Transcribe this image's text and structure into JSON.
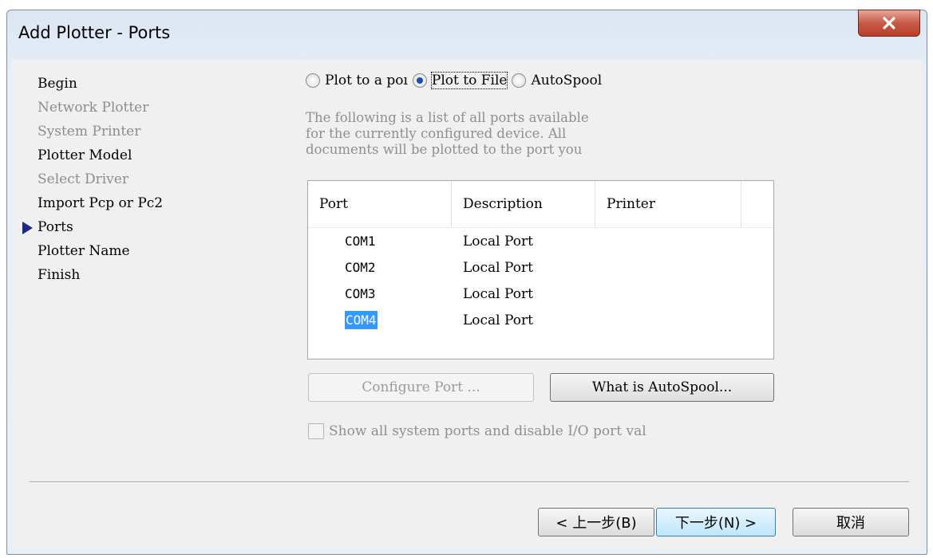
{
  "window": {
    "title": "Add Plotter - Ports"
  },
  "steps": [
    {
      "label": "Begin",
      "state": "enabled"
    },
    {
      "label": "Network Plotter",
      "state": "disabled"
    },
    {
      "label": "System Printer",
      "state": "disabled"
    },
    {
      "label": "Plotter Model",
      "state": "enabled"
    },
    {
      "label": "Select Driver",
      "state": "disabled"
    },
    {
      "label": "Import Pcp or Pc2",
      "state": "enabled"
    },
    {
      "label": "Ports",
      "state": "current"
    },
    {
      "label": "Plotter Name",
      "state": "enabled"
    },
    {
      "label": "Finish",
      "state": "enabled"
    }
  ],
  "output_options": {
    "plot_to_port": "Plot to a poı",
    "plot_to_file": "Plot to File",
    "autospool": "AutoSpool",
    "selected": "plot_to_file"
  },
  "description": "The following is a list of all ports available\nfor the currently configured device. All\ndocuments will be plotted to the port you",
  "ports_table": {
    "columns": [
      "Port",
      "Description",
      "Printer"
    ],
    "rows": [
      {
        "port": "COM1",
        "description": "Local Port",
        "printer": ""
      },
      {
        "port": "COM2",
        "description": "Local Port",
        "printer": ""
      },
      {
        "port": "COM3",
        "description": "Local Port",
        "printer": ""
      },
      {
        "port": "COM4",
        "description": "Local Port",
        "printer": ""
      }
    ],
    "selected_row": 3
  },
  "buttons": {
    "configure_port": "Configure Port ...",
    "what_is_autospool": "What is AutoSpool...",
    "back": "< 上一步(B)",
    "next": "下一步(N) >",
    "cancel": "取消"
  },
  "checkbox": {
    "label": "Show all system ports and disable I/O port val",
    "checked": false
  },
  "colors": {
    "selection": "#3399ff",
    "title_close": "#c75a45"
  }
}
